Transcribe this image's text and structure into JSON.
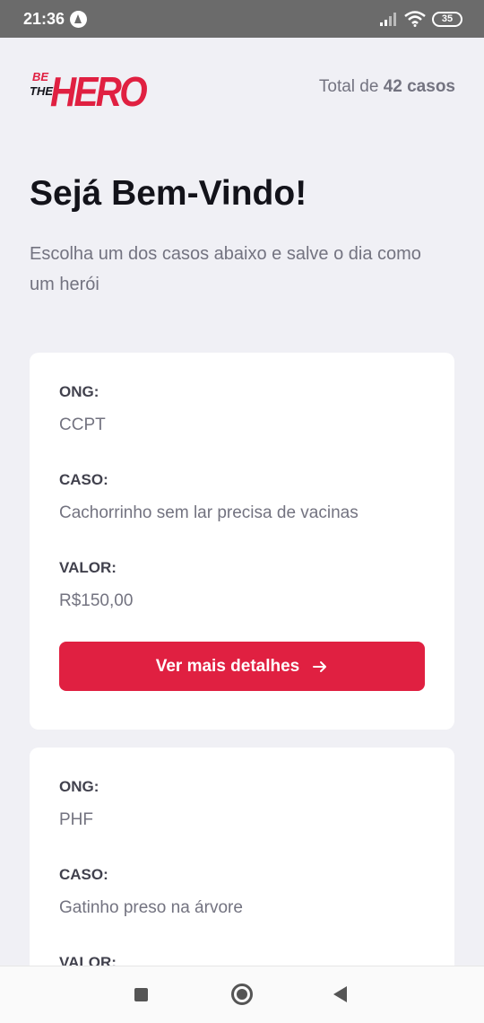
{
  "status_bar": {
    "time": "21:36",
    "battery": "35"
  },
  "header": {
    "logo_text_small_1": "BE",
    "logo_text_small_2": "THE",
    "logo_text_big": "HERO",
    "total_prefix": "Total de ",
    "total_count": "42 casos"
  },
  "main": {
    "title": "Sejá Bem-Vindo!",
    "subtitle": "Escolha um dos casos abaixo e salve o dia como um herói"
  },
  "labels": {
    "ong": "ONG:",
    "caso": "CASO:",
    "valor": "VALOR:"
  },
  "incidents": [
    {
      "ong": "CCPT",
      "caso": "Cachorrinho sem lar precisa de vacinas",
      "valor": "R$150,00",
      "button_label": "Ver mais detalhes"
    },
    {
      "ong": "PHF",
      "caso": "Gatinho preso na árvore",
      "valor": ""
    }
  ],
  "colors": {
    "brand": "#e02041",
    "background": "#f0f0f5"
  }
}
